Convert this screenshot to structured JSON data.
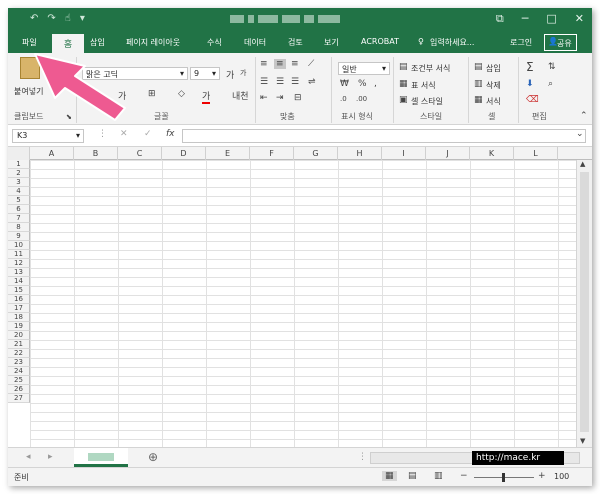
{
  "qat": {
    "undo": "↶",
    "redo": "↷",
    "touch": "☝",
    "customize": "▾"
  },
  "window": {
    "restore": "⧉",
    "minimize": "─",
    "maximize": "□",
    "close": "✕"
  },
  "tabs": [
    {
      "label": "파일"
    },
    {
      "label": "홈"
    },
    {
      "label": "삽입"
    },
    {
      "label": "페이지 레이아웃"
    },
    {
      "label": "수식"
    },
    {
      "label": "데이터"
    },
    {
      "label": "검토"
    },
    {
      "label": "보기"
    },
    {
      "label": "ACROBAT"
    }
  ],
  "tellme": "입력하세요...",
  "signin": "로그인",
  "share": "공유",
  "ribbon": {
    "paste": "붙여넣기",
    "font_name": "맑은 고딕",
    "font_size": "9",
    "grow": "가",
    "shrink": "가",
    "underline": "가",
    "font_color": "가",
    "korean": "내천",
    "number_format": "일반",
    "percent": "%",
    "comma": ",",
    "conditional": "조건부 서식",
    "table_format": "표 서식",
    "cell_style": "셀 스타일",
    "insert": "삽입",
    "delete": "삭제",
    "format": "서식",
    "sum": "Σ",
    "groups": [
      "클립보드",
      "글꼴",
      "맞춤",
      "표시 형식",
      "스타일",
      "셀",
      "편집"
    ]
  },
  "formula": {
    "cell_ref": "K3",
    "fx": "fx"
  },
  "columns": [
    "A",
    "B",
    "C",
    "D",
    "E",
    "F",
    "G",
    "H",
    "I",
    "J",
    "K",
    "L"
  ],
  "rows": [
    "1",
    "2",
    "3",
    "4",
    "5",
    "6",
    "7",
    "8",
    "9",
    "10",
    "11",
    "12",
    "13",
    "14",
    "15",
    "16",
    "17",
    "18",
    "19",
    "20",
    "21",
    "22",
    "23",
    "24",
    "25",
    "26",
    "27"
  ],
  "sheetbar": {
    "add": "⊕"
  },
  "status": {
    "ready": "준비",
    "zoom": "100",
    "minus": "−",
    "plus": "+"
  },
  "watermark": "http://mace.kr",
  "colors": {
    "brand": "#217346",
    "arrow": "#ee5a91"
  },
  "icons": [
    "undo-icon",
    "redo-icon",
    "paste-icon",
    "bold-icon",
    "border-icon",
    "fill-color-icon",
    "font-color-icon",
    "align-icon",
    "merge-icon",
    "percent-icon",
    "conditional-format-icon",
    "table-format-icon",
    "cell-style-icon",
    "insert-icon",
    "delete-icon",
    "format-icon",
    "sum-icon",
    "fill-icon",
    "clear-icon",
    "sort-icon",
    "find-icon",
    "share-icon",
    "lightbulb-icon",
    "fx-icon",
    "add-sheet-icon",
    "normal-view-icon",
    "page-layout-icon",
    "page-break-icon"
  ]
}
